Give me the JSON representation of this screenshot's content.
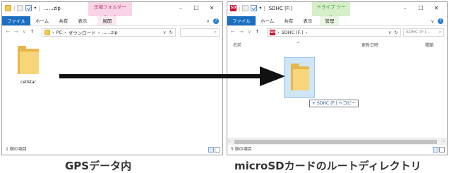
{
  "left_window": {
    "title": "……zip",
    "context_tab": "圧縮フォルダー ツール",
    "tabs": [
      "ファイル",
      "ホーム",
      "共有",
      "表示",
      "展開"
    ],
    "path": [
      "PC",
      "ダウンロード",
      "……zip"
    ],
    "item": {
      "name": "cellstar"
    },
    "status": "1 個の項目"
  },
  "right_window": {
    "title": "SDHC (F:)",
    "context_tab": "ドライブ ツール",
    "tabs": [
      "ファイル",
      "ホーム",
      "共有",
      "表示",
      "管理"
    ],
    "path": [
      "SDHC (F:)"
    ],
    "search_placeholder": "SDHC (F:)...",
    "columns": [
      "名前",
      "更新日時",
      "種類"
    ],
    "drag_tip": "SDHC (F:) へコピー",
    "status": "5 個の項目"
  },
  "window_controls": [
    "–",
    "☐",
    "✕"
  ],
  "captions": {
    "left": "GPSデータ内",
    "right": "microSDカードのルートディレクトリ"
  },
  "colors": {
    "file_tab": "#1a6fc0",
    "pink_ctx": "#f7d4e6",
    "green_ctx": "#d5efc9",
    "arrow": "#111111",
    "folder": "#f7d57a"
  },
  "icons": [
    "folder-icon",
    "checkbox-icon",
    "sd-card-icon",
    "help-icon",
    "arrow-icon"
  ]
}
